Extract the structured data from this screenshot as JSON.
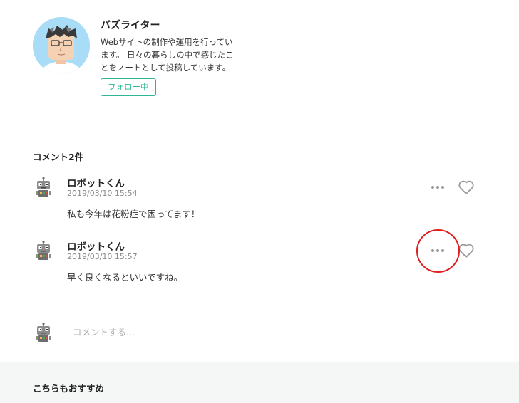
{
  "author": {
    "name": "バズライター",
    "bio_lines": [
      "Webサイトの制作や運用を行ってい",
      "ます。 日々の暮らしの中で感じたこ",
      "とをノートとして投稿しています。"
    ],
    "follow_label": "フォロー中",
    "avatar_icon": "author-avatar-illustration"
  },
  "comments": {
    "heading": "コメント2件",
    "items": [
      {
        "name": "ロボットくん",
        "date": "2019/03/10 15:54",
        "text": "私も今年は花粉症で困ってます！",
        "avatar_icon": "robot-avatar"
      },
      {
        "name": "ロボットくん",
        "date": "2019/03/10 15:57",
        "text": "早く良くなるといいですね。",
        "avatar_icon": "robot-avatar"
      }
    ],
    "input_placeholder": "コメントする..."
  },
  "recommend": {
    "heading": "こちらもおすすめ"
  },
  "colors": {
    "accent": "#2cb696",
    "annotation": "#e02020",
    "icon_gray": "#9a9a9a",
    "section_bg": "#f5f6f6"
  }
}
